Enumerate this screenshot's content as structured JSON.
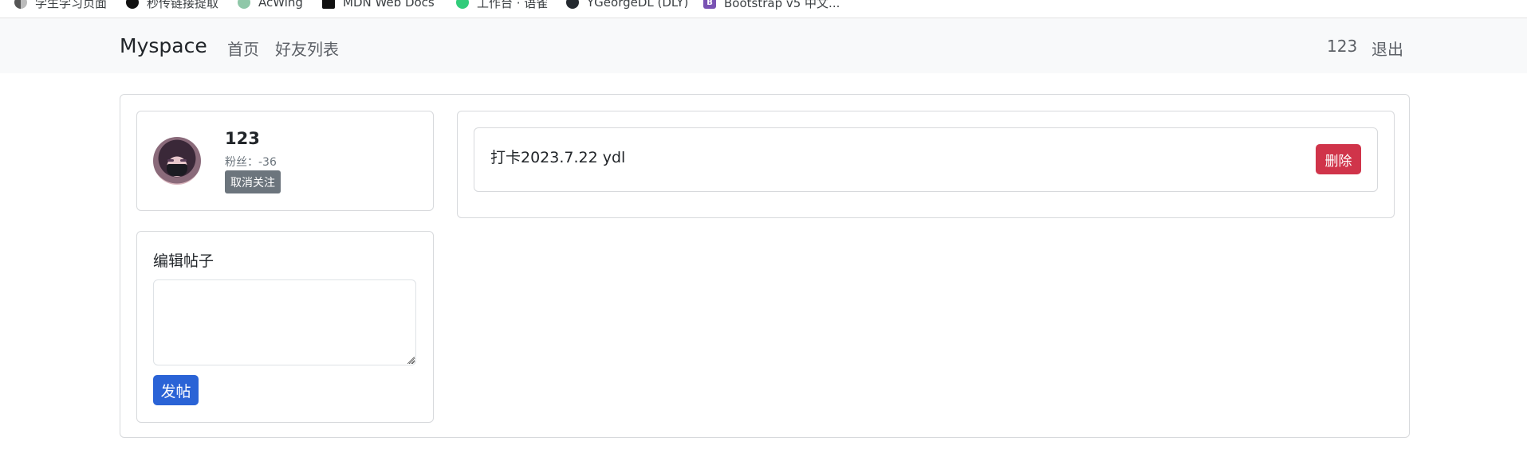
{
  "bookmarks": [
    {
      "label": "学生学习页面",
      "icon": "half-circle-icon"
    },
    {
      "label": "秒传链接提取",
      "icon": "link-icon"
    },
    {
      "label": "AcWing",
      "icon": "acwing-icon"
    },
    {
      "label": "MDN Web Docs",
      "icon": "mdn-icon"
    },
    {
      "label": "工作台 · 语雀",
      "icon": "yuque-icon"
    },
    {
      "label": "YGeorgeDL (DLY)",
      "icon": "github-icon"
    },
    {
      "label": "Bootstrap v5 中文...",
      "icon": "bootstrap-icon"
    }
  ],
  "navbar": {
    "brand": "Myspace",
    "links": [
      "首页",
      "好友列表"
    ],
    "user": "123",
    "logout": "退出"
  },
  "profile": {
    "username": "123",
    "fans": "粉丝：-36",
    "unfollow_label": "取消关注"
  },
  "editor": {
    "title": "编辑帖子",
    "textarea_value": "",
    "post_label": "发帖"
  },
  "posts": [
    {
      "content": "打卡2023.7.22 ydl",
      "delete_label": "删除"
    }
  ],
  "colors": {
    "navbar_bg": "#f8f9fa",
    "primary": "#2a63d6",
    "danger": "#d0344a",
    "secondary": "#6c757d"
  }
}
